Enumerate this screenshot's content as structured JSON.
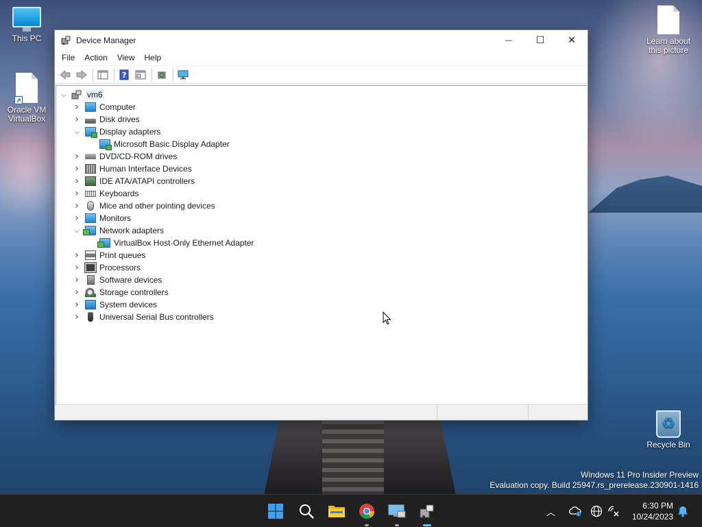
{
  "desktop": {
    "icons": [
      {
        "label": "This PC",
        "icon": "this-pc-icon"
      },
      {
        "label": "Oracle VM VirtualBox",
        "icon": "virtualbox-shortcut-icon"
      },
      {
        "label": "Learn about this picture",
        "icon": "file-icon"
      },
      {
        "label": "Recycle Bin",
        "icon": "recycle-bin-icon"
      }
    ],
    "watermark": {
      "line1": "Windows 11 Pro Insider Preview",
      "line2": "Evaluation copy. Build 25947.rs_prerelease.230901-1416"
    }
  },
  "window": {
    "title": "Device Manager",
    "controls": {
      "minimize": "—",
      "maximize": "☐",
      "close": "✕"
    },
    "menu": [
      "File",
      "Action",
      "View",
      "Help"
    ],
    "toolbar": [
      "back-icon",
      "forward-icon",
      "show-hide-console-tree-icon",
      "help-icon",
      "properties-icon",
      "scan-hardware-icon",
      "monitor-icon"
    ],
    "tree": {
      "root": "vm6",
      "items": [
        {
          "label": "Computer",
          "icon": "computer-icon",
          "expanded": false
        },
        {
          "label": "Disk drives",
          "icon": "disk-drive-icon",
          "expanded": false
        },
        {
          "label": "Display adapters",
          "icon": "display-adapter-icon",
          "expanded": true
        },
        {
          "label": "Microsoft Basic Display Adapter",
          "icon": "display-adapter-icon",
          "child": true
        },
        {
          "label": "DVD/CD-ROM drives",
          "icon": "dvd-drive-icon",
          "expanded": false
        },
        {
          "label": "Human Interface Devices",
          "icon": "hid-icon",
          "expanded": false
        },
        {
          "label": "IDE ATA/ATAPI controllers",
          "icon": "ide-controller-icon",
          "expanded": false
        },
        {
          "label": "Keyboards",
          "icon": "keyboard-icon",
          "expanded": false
        },
        {
          "label": "Mice and other pointing devices",
          "icon": "mouse-icon",
          "expanded": false
        },
        {
          "label": "Monitors",
          "icon": "monitor-icon",
          "expanded": false
        },
        {
          "label": "Network adapters",
          "icon": "network-adapter-icon",
          "expanded": true
        },
        {
          "label": "VirtualBox Host-Only Ethernet Adapter",
          "icon": "network-adapter-icon",
          "child": true
        },
        {
          "label": "Print queues",
          "icon": "printer-icon",
          "expanded": false
        },
        {
          "label": "Processors",
          "icon": "processor-icon",
          "expanded": false
        },
        {
          "label": "Software devices",
          "icon": "software-device-icon",
          "expanded": false
        },
        {
          "label": "Storage controllers",
          "icon": "storage-controller-icon",
          "expanded": false
        },
        {
          "label": "System devices",
          "icon": "system-device-icon",
          "expanded": false
        },
        {
          "label": "Universal Serial Bus controllers",
          "icon": "usb-icon",
          "expanded": false
        }
      ]
    }
  },
  "taskbar": {
    "apps": [
      "start-icon",
      "search-icon",
      "file-explorer-icon",
      "chrome-icon",
      "remote-desktop-icon",
      "device-manager-icon"
    ],
    "clock": {
      "time": "6:30 PM",
      "date": "10/24/2023"
    },
    "tray": [
      "show-hidden-icons-chevron",
      "onedrive-icon",
      "language-network-icon",
      "network-disconnected-icon",
      "notifications-bell-icon"
    ]
  },
  "colors": {
    "taskbar_bg": "#202020",
    "accent": "#5cc5ff",
    "selection": "#e5f0fb"
  }
}
